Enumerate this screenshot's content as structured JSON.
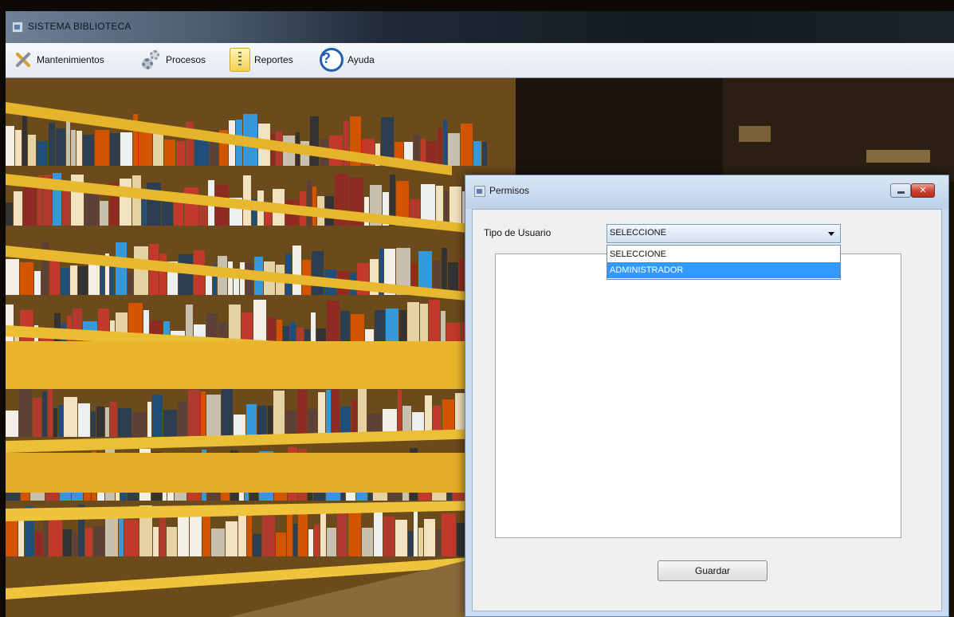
{
  "main_window": {
    "title": "SISTEMA BIBLIOTECA"
  },
  "menu": {
    "items": [
      {
        "label": "Mantenimientos",
        "icon": "tools-icon"
      },
      {
        "label": "Procesos",
        "icon": "gears-icon"
      },
      {
        "label": "Reportes",
        "icon": "report-icon"
      },
      {
        "label": "Ayuda",
        "icon": "help-icon"
      }
    ]
  },
  "dialog": {
    "title": "Permisos",
    "tipo_usuario_label": "Tipo de Usuario",
    "combo_selected": "SELECCIONE",
    "options": [
      "SELECCIONE",
      "ADMINISTRADOR"
    ],
    "highlighted_option": "ADMINISTRADOR",
    "guardar_label": "Guardar"
  },
  "colors": {
    "selection_blue": "#3399ff",
    "close_red": "#c9402c",
    "shelf_yellow": "#e5b42a"
  }
}
